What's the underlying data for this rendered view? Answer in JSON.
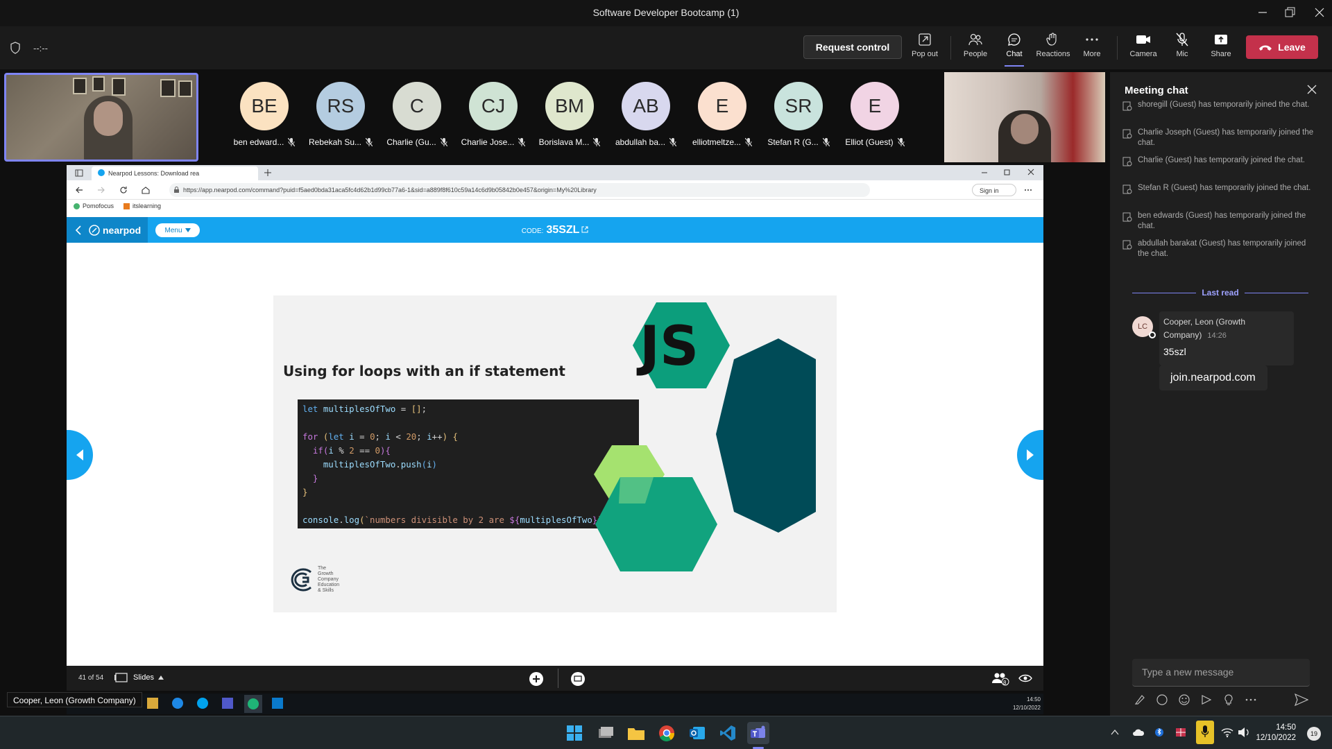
{
  "window": {
    "title": "Software Developer Bootcamp (1)"
  },
  "toolbar": {
    "timer": "--:--",
    "request_control": "Request control",
    "buttons": [
      {
        "label": "Pop out",
        "icon": "popout-icon"
      },
      {
        "label": "People",
        "icon": "people-icon"
      },
      {
        "label": "Chat",
        "icon": "chat-icon",
        "active": true
      },
      {
        "label": "Reactions",
        "icon": "reactions-icon"
      },
      {
        "label": "More",
        "icon": "more-icon"
      },
      {
        "label": "Camera",
        "icon": "camera-icon"
      },
      {
        "label": "Mic",
        "icon": "mic-off-icon"
      },
      {
        "label": "Share",
        "icon": "share-icon"
      }
    ],
    "leave": "Leave"
  },
  "participants": [
    {
      "initials": "BE",
      "name": "ben edward...",
      "color": "#fbe2c1"
    },
    {
      "initials": "RS",
      "name": "Rebekah Su...",
      "color": "#b4cce0"
    },
    {
      "initials": "C",
      "name": "Charlie (Gu...",
      "color": "#d8dcd2"
    },
    {
      "initials": "CJ",
      "name": "Charlie Jose...",
      "color": "#cfe3d4"
    },
    {
      "initials": "BM",
      "name": "Borislava M...",
      "color": "#dfe7cd"
    },
    {
      "initials": "AB",
      "name": "abdullah ba...",
      "color": "#d8d8ee"
    },
    {
      "initials": "E",
      "name": "elliotmeltze...",
      "color": "#fbe0cf"
    },
    {
      "initials": "SR",
      "name": "Stefan R (G...",
      "color": "#c9e3dd"
    },
    {
      "initials": "E",
      "name": "Elliot (Guest)",
      "color": "#f1d4e4"
    }
  ],
  "browser": {
    "tab_title": "Nearpod Lessons: Download rea",
    "url": "https://app.nearpod.com/command?puid=f5aed0bda31aca5fc4d62b1d99cb77a6-1&sid=a889f8f610c59a14c6d9b05842b0e457&origin=My%20Library",
    "sign_in": "Sign in",
    "favorites": [
      "Pomofocus",
      "itslearning"
    ]
  },
  "nearpod": {
    "logo": "nearpod",
    "menu": "Menu",
    "code_label": "CODE:",
    "code": "35SZL",
    "slide_counter": "41 of 54",
    "slides_label": "Slides",
    "participants_count": "8"
  },
  "slide": {
    "title": "Using for loops with an if statement",
    "js_logo": "JS",
    "company_lines": [
      "The",
      "Growth",
      "Company",
      "Education",
      "& Skills"
    ]
  },
  "inner_taskbar": {
    "time": "14:50",
    "date": "12/10/2022"
  },
  "tooltip": "Cooper, Leon (Growth Company)",
  "chat": {
    "title": "Meeting chat",
    "system_messages": [
      "shoregill (Guest) has temporarily joined the chat.",
      "Charlie Joseph (Guest) has temporarily joined the chat.",
      "Charlie (Guest) has temporarily joined the chat.",
      "Stefan R (Guest) has temporarily joined the chat.",
      "ben edwards (Guest) has temporarily joined the chat.",
      "abdullah barakat (Guest) has temporarily joined the chat."
    ],
    "last_read": "Last read",
    "message": {
      "avatar": "LC",
      "author": "Cooper, Leon (Growth Company)",
      "time": "14:26",
      "text": "35szl",
      "link": "join.nearpod.com"
    },
    "compose_placeholder": "Type a new message"
  },
  "taskbar": {
    "time": "14:50",
    "date": "12/10/2022",
    "notifications": "19"
  }
}
